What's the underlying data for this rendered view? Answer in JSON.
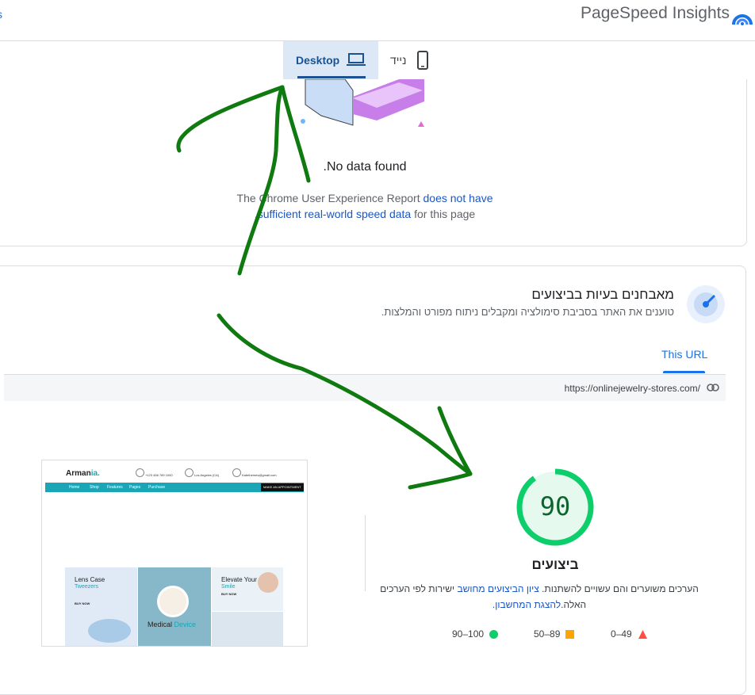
{
  "header": {
    "app_title": "PageSpeed Insights",
    "left_crumb_fragment": "s",
    "logo_icon": "pagespeed-logo-icon"
  },
  "device_tabs": {
    "desktop_label": "Desktop",
    "mobile_label": "נייד",
    "active": "Desktop",
    "desktop_icon": "laptop-icon",
    "mobile_icon": "phone-icon"
  },
  "field_data": {
    "title": ".No data found",
    "text_before_link1": "The Chrome User Experience Report ",
    "link1": "does not have",
    "link2": "sufficient real-world speed data",
    "text_after_link2": " for this page",
    "prefix_dot": "."
  },
  "diagnostics": {
    "title": "מאבחנים בעיות בביצועים",
    "subtitle": "טוענים את האתר בסביבת סימולציה ומקבלים ניתוח מפורט והמלצות.",
    "tab_label": "This URL",
    "url": "https://onlinejewelry-stores.com/",
    "icon": "gauge-icon"
  },
  "thumbnail": {
    "logo_main": "Arman",
    "logo_accent": "ia.",
    "phone": "+123 456 789 1000",
    "city": "Los Angeles (CA)",
    "email": "Katethemes@gmail.com",
    "nav": [
      "Home",
      "Shop",
      "Features",
      "Pages",
      "Purchase"
    ],
    "cta": "MAKE AN APPOINTMENT",
    "promo1_title": "Lens Case",
    "promo1_accent": "Tweezers",
    "promo1_link": "BUY NOW",
    "promo2_title": "Medical",
    "promo2_accent": "Device",
    "promo3_title": "Elevate Your",
    "promo3_accent": "Smile",
    "promo3_link": "BUY NOW"
  },
  "score": {
    "value": 90,
    "value_text": "90",
    "label": "ביצועים",
    "note_part1": "הערכים משוערים והם עשויים להשתנות. ",
    "note_link1": "ציון הביצועים מחושב",
    "note_part2": " ישירות לפי הערכים",
    "note_part3": "האלה.",
    "note_link2": "להצגת המחשבון.",
    "ring_color": "#0cce6b",
    "text_color": "#0d652d"
  },
  "legend": [
    {
      "range": "0–49",
      "shape": "triangle",
      "color": "#ff4e42"
    },
    {
      "range": "50–89",
      "shape": "square",
      "color": "#ffa400"
    },
    {
      "range": "90–100",
      "shape": "circle",
      "color": "#0cce6b"
    }
  ],
  "annotation_color": "#0f7a0f"
}
